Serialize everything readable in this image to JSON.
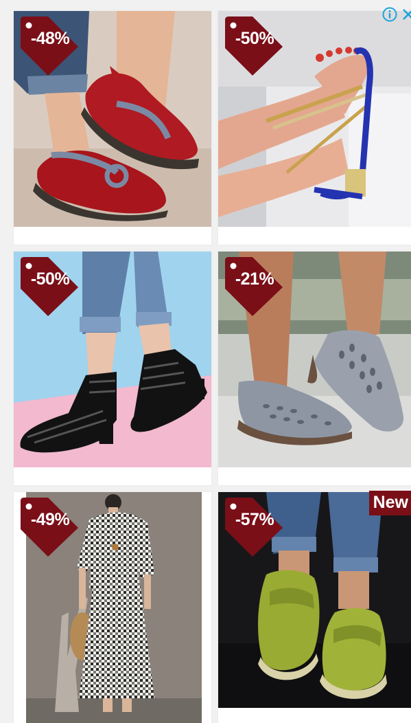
{
  "ad": {
    "info_icon": "info-icon",
    "close_icon": "close-icon",
    "accent_color": "#7a0f18",
    "info_color": "#1aa3d9"
  },
  "products": [
    {
      "discount": "-48%"
    },
    {
      "discount": "-50%"
    },
    {
      "discount": "-50%"
    },
    {
      "discount": "-21%"
    },
    {
      "discount": "-49%"
    },
    {
      "discount": "-57%",
      "badge": "New"
    }
  ]
}
